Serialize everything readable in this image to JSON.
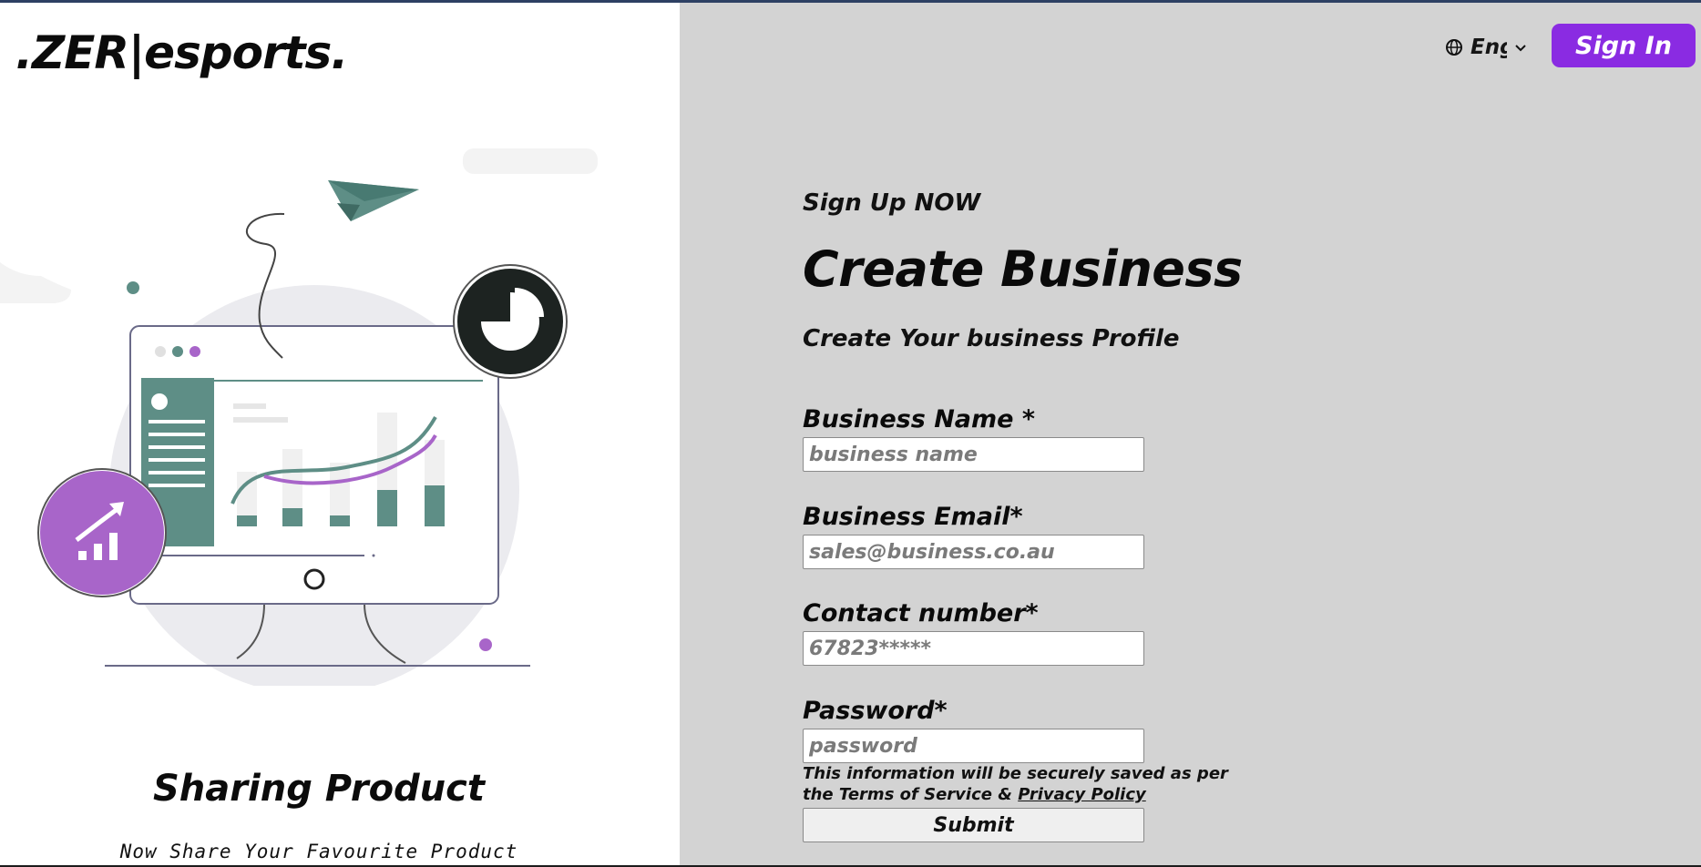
{
  "brand": {
    "logo_text": ".ZER|esports."
  },
  "hero": {
    "title": "Sharing Product",
    "subtitle": "Now Share Your Favourite Product"
  },
  "header": {
    "language_label": "English",
    "signin_label": "Sign In"
  },
  "form": {
    "kicker": "Sign Up NOW",
    "title": "Create Business",
    "subtitle": "Create Your business Profile",
    "fields": {
      "business_name": {
        "label": "Business Name *",
        "placeholder": "business name"
      },
      "business_email": {
        "label": "Business Email*",
        "placeholder": "sales@business.co.au"
      },
      "contact_number": {
        "label": "Contact number*",
        "placeholder": "67823*****"
      },
      "password": {
        "label": "Password*",
        "placeholder": "password"
      }
    },
    "notice_text": "This information will be securely saved as per the Terms of Service & ",
    "privacy_link": "Privacy Policy",
    "submit_label": "Submit"
  },
  "colors": {
    "accent": "#8a2be2",
    "teal": "#5e8e86",
    "purple": "#a865c9",
    "panel_gray": "#d3d3d3"
  },
  "icons": [
    "globe-icon",
    "chevron-down-icon",
    "pie-chart-icon",
    "growth-chart-icon",
    "paper-plane-icon"
  ]
}
